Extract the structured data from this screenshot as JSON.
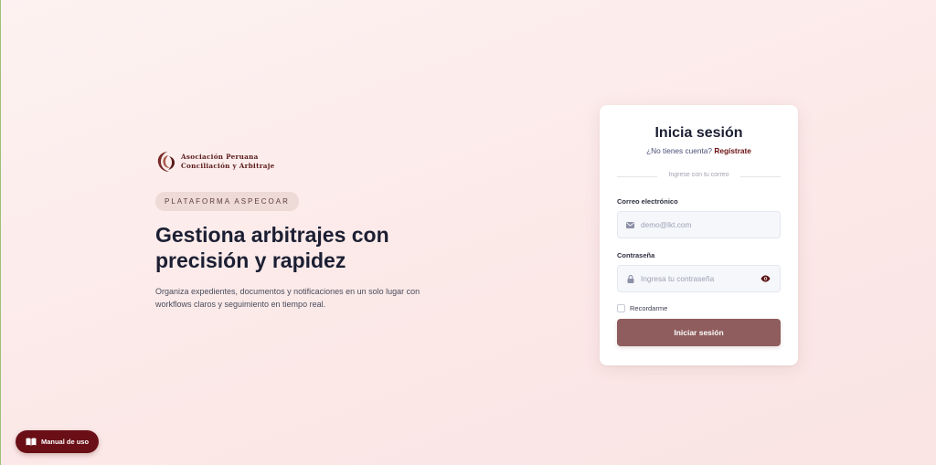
{
  "brand": {
    "logo_line1": "Asociación Peruana",
    "logo_line2": "Conciliación y Arbitraje",
    "badge": "PLATAFORMA ASPECOAR"
  },
  "hero": {
    "headline": "Gestiona arbitrajes con precisión y rapidez",
    "subtext": "Organiza expedientes, documentos y notificaciones en un solo lugar con workflows claros y seguimiento en tiempo real."
  },
  "login": {
    "title": "Inicia sesión",
    "no_account": "¿No tienes cuenta?",
    "register_link": "Regístrate",
    "divider_text": "Ingrese con tu correo",
    "email_label": "Correo electrónico",
    "email_placeholder": "demo@lkt.com",
    "password_label": "Contraseña",
    "password_placeholder": "Ingresa tu contraseña",
    "remember_label": "Recordarme",
    "submit_label": "Iniciar sesión"
  },
  "manual": {
    "label": "Manual de uso"
  },
  "icons": {
    "email": "envelope-icon",
    "password": "lock-icon",
    "toggle": "eye-icon",
    "manual": "book-icon"
  },
  "colors": {
    "accent": "#8f5d5d",
    "brand_dark": "#6a0f16",
    "link": "#6b1111"
  }
}
